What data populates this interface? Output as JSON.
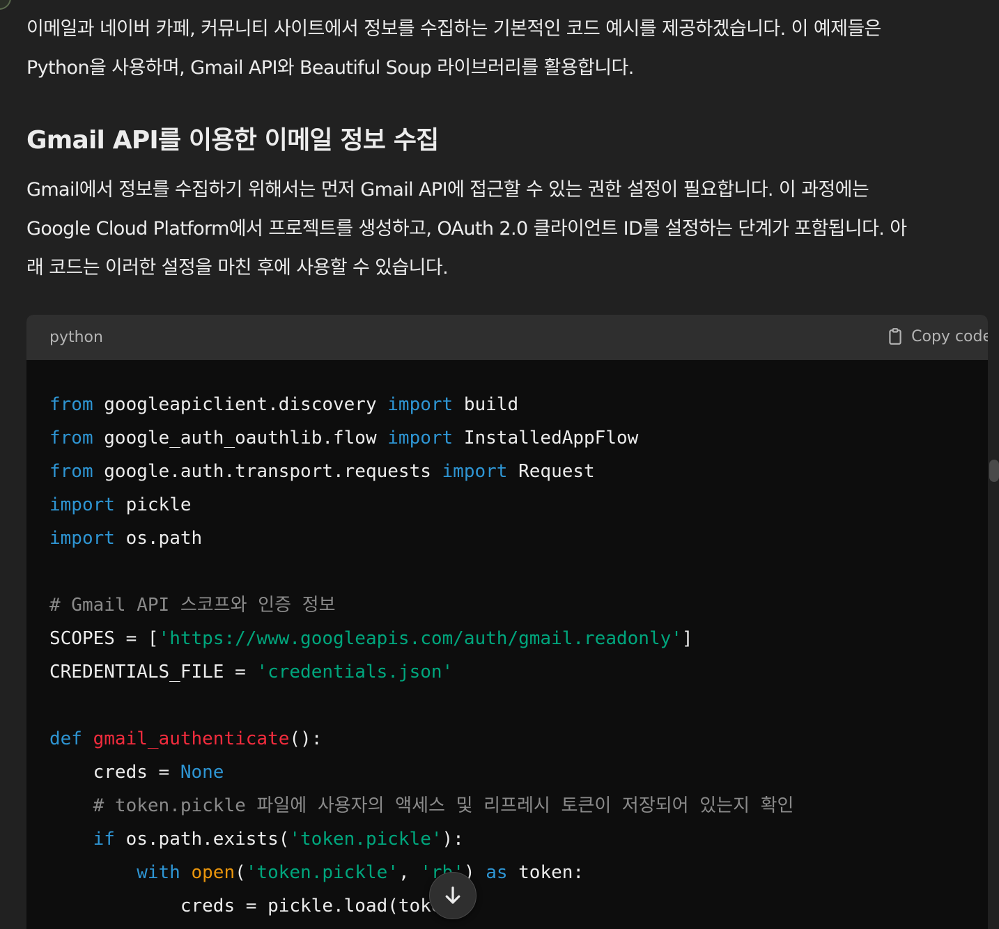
{
  "message": {
    "paragraph1_line1": "이메일과 네이버 카페, 커뮤니티 사이트에서 정보를 수집하는 기본적인 코드 예시를 제공하겠습니다. 이 예제들은",
    "paragraph1_line2": "Python을 사용하며, Gmail API와 Beautiful Soup 라이브러리를 활용합니다.",
    "heading": "Gmail API를 이용한 이메일 정보 수집",
    "paragraph2_line1": "Gmail에서 정보를 수집하기 위해서는 먼저 Gmail API에 접근할 수 있는 권한 설정이 필요합니다. 이 과정에는",
    "paragraph2_line2": "Google Cloud Platform에서 프로젝트를 생성하고, OAuth 2.0 클라이언트 ID를 설정하는 단계가 포함됩니다. 아",
    "paragraph2_line3": "래 코드는 이러한 설정을 마친 후에 사용할 수 있습니다."
  },
  "code_block": {
    "language": "python",
    "copy_label": "Copy code",
    "lines": [
      "",
      "",
      "",
      "",
      "",
      "",
      "# Gmail API 스코프와 인증 정보",
      "",
      "",
      "",
      "",
      "",
      "    # token.pickle 파일에 사용자의 액세스 및 리프레시 토큰이 저장되어 있는지 확인",
      "",
      "",
      ""
    ],
    "tokens": {
      "l1_from": "from",
      "l1_mod": " googleapiclient.discovery ",
      "l1_import": "import",
      "l1_name": " build",
      "l2_from": "from",
      "l2_mod": " google_auth_oauthlib.flow ",
      "l2_import": "import",
      "l2_name": " InstalledAppFlow",
      "l3_from": "from",
      "l3_mod": " google.auth.transport.requests ",
      "l3_import": "import",
      "l3_name": " Request",
      "l4_import": "import",
      "l4_name": " pickle",
      "l5_import": "import",
      "l5_name": " os.path",
      "l8_a": "SCOPES = [",
      "l8_str": "'https://www.googleapis.com/auth/gmail.readonly'",
      "l8_b": "]",
      "l9_a": "CREDENTIALS_FILE = ",
      "l9_str": "'credentials.json'",
      "l11_def": "def",
      "l11_fn": " gmail_authenticate",
      "l11_b": "():",
      "l12_a": "    creds = ",
      "l12_none": "None",
      "l14_if": "    if",
      "l14_a": " os.path.exists(",
      "l14_str": "'token.pickle'",
      "l14_b": "):",
      "l15_with": "        with",
      "l15_sp": " ",
      "l15_open": "open",
      "l15_a": "(",
      "l15_str1": "'token.pickle'",
      "l15_c": ", ",
      "l15_str2": "'rb'",
      "l15_d": ") ",
      "l15_as": "as",
      "l15_e": " token:",
      "l16_a": "            creds = pickle.load(token)"
    }
  },
  "icons": {
    "copy": "clipboard-icon",
    "scroll_down": "arrow-down-icon"
  }
}
